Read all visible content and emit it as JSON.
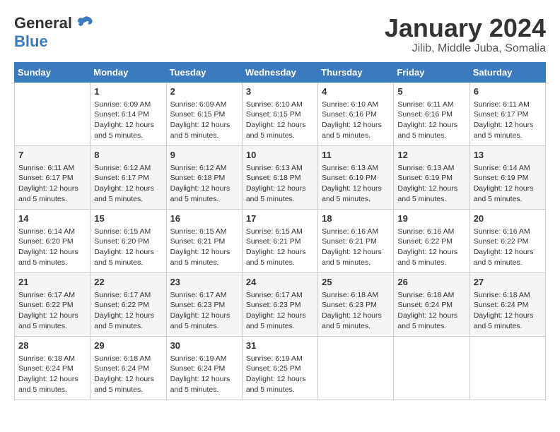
{
  "logo": {
    "line1": "General",
    "line2": "Blue"
  },
  "title": "January 2024",
  "subtitle": "Jilib, Middle Juba, Somalia",
  "days_header": [
    "Sunday",
    "Monday",
    "Tuesday",
    "Wednesday",
    "Thursday",
    "Friday",
    "Saturday"
  ],
  "weeks": [
    [
      {
        "day": "",
        "info": ""
      },
      {
        "day": "1",
        "info": "Sunrise: 6:09 AM\nSunset: 6:14 PM\nDaylight: 12 hours\nand 5 minutes."
      },
      {
        "day": "2",
        "info": "Sunrise: 6:09 AM\nSunset: 6:15 PM\nDaylight: 12 hours\nand 5 minutes."
      },
      {
        "day": "3",
        "info": "Sunrise: 6:10 AM\nSunset: 6:15 PM\nDaylight: 12 hours\nand 5 minutes."
      },
      {
        "day": "4",
        "info": "Sunrise: 6:10 AM\nSunset: 6:16 PM\nDaylight: 12 hours\nand 5 minutes."
      },
      {
        "day": "5",
        "info": "Sunrise: 6:11 AM\nSunset: 6:16 PM\nDaylight: 12 hours\nand 5 minutes."
      },
      {
        "day": "6",
        "info": "Sunrise: 6:11 AM\nSunset: 6:17 PM\nDaylight: 12 hours\nand 5 minutes."
      }
    ],
    [
      {
        "day": "7",
        "info": "Sunrise: 6:11 AM\nSunset: 6:17 PM\nDaylight: 12 hours\nand 5 minutes."
      },
      {
        "day": "8",
        "info": "Sunrise: 6:12 AM\nSunset: 6:17 PM\nDaylight: 12 hours\nand 5 minutes."
      },
      {
        "day": "9",
        "info": "Sunrise: 6:12 AM\nSunset: 6:18 PM\nDaylight: 12 hours\nand 5 minutes."
      },
      {
        "day": "10",
        "info": "Sunrise: 6:13 AM\nSunset: 6:18 PM\nDaylight: 12 hours\nand 5 minutes."
      },
      {
        "day": "11",
        "info": "Sunrise: 6:13 AM\nSunset: 6:19 PM\nDaylight: 12 hours\nand 5 minutes."
      },
      {
        "day": "12",
        "info": "Sunrise: 6:13 AM\nSunset: 6:19 PM\nDaylight: 12 hours\nand 5 minutes."
      },
      {
        "day": "13",
        "info": "Sunrise: 6:14 AM\nSunset: 6:19 PM\nDaylight: 12 hours\nand 5 minutes."
      }
    ],
    [
      {
        "day": "14",
        "info": "Sunrise: 6:14 AM\nSunset: 6:20 PM\nDaylight: 12 hours\nand 5 minutes."
      },
      {
        "day": "15",
        "info": "Sunrise: 6:15 AM\nSunset: 6:20 PM\nDaylight: 12 hours\nand 5 minutes."
      },
      {
        "day": "16",
        "info": "Sunrise: 6:15 AM\nSunset: 6:21 PM\nDaylight: 12 hours\nand 5 minutes."
      },
      {
        "day": "17",
        "info": "Sunrise: 6:15 AM\nSunset: 6:21 PM\nDaylight: 12 hours\nand 5 minutes."
      },
      {
        "day": "18",
        "info": "Sunrise: 6:16 AM\nSunset: 6:21 PM\nDaylight: 12 hours\nand 5 minutes."
      },
      {
        "day": "19",
        "info": "Sunrise: 6:16 AM\nSunset: 6:22 PM\nDaylight: 12 hours\nand 5 minutes."
      },
      {
        "day": "20",
        "info": "Sunrise: 6:16 AM\nSunset: 6:22 PM\nDaylight: 12 hours\nand 5 minutes."
      }
    ],
    [
      {
        "day": "21",
        "info": "Sunrise: 6:17 AM\nSunset: 6:22 PM\nDaylight: 12 hours\nand 5 minutes."
      },
      {
        "day": "22",
        "info": "Sunrise: 6:17 AM\nSunset: 6:22 PM\nDaylight: 12 hours\nand 5 minutes."
      },
      {
        "day": "23",
        "info": "Sunrise: 6:17 AM\nSunset: 6:23 PM\nDaylight: 12 hours\nand 5 minutes."
      },
      {
        "day": "24",
        "info": "Sunrise: 6:17 AM\nSunset: 6:23 PM\nDaylight: 12 hours\nand 5 minutes."
      },
      {
        "day": "25",
        "info": "Sunrise: 6:18 AM\nSunset: 6:23 PM\nDaylight: 12 hours\nand 5 minutes."
      },
      {
        "day": "26",
        "info": "Sunrise: 6:18 AM\nSunset: 6:24 PM\nDaylight: 12 hours\nand 5 minutes."
      },
      {
        "day": "27",
        "info": "Sunrise: 6:18 AM\nSunset: 6:24 PM\nDaylight: 12 hours\nand 5 minutes."
      }
    ],
    [
      {
        "day": "28",
        "info": "Sunrise: 6:18 AM\nSunset: 6:24 PM\nDaylight: 12 hours\nand 5 minutes."
      },
      {
        "day": "29",
        "info": "Sunrise: 6:18 AM\nSunset: 6:24 PM\nDaylight: 12 hours\nand 5 minutes."
      },
      {
        "day": "30",
        "info": "Sunrise: 6:19 AM\nSunset: 6:24 PM\nDaylight: 12 hours\nand 5 minutes."
      },
      {
        "day": "31",
        "info": "Sunrise: 6:19 AM\nSunset: 6:25 PM\nDaylight: 12 hours\nand 5 minutes."
      },
      {
        "day": "",
        "info": ""
      },
      {
        "day": "",
        "info": ""
      },
      {
        "day": "",
        "info": ""
      }
    ]
  ]
}
